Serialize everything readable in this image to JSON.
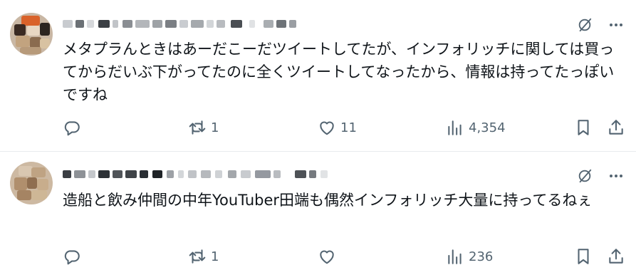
{
  "tweets": [
    {
      "text": "メタプラんときはあーだこーだツイートしてたが、インフォリッチに関しては買ってからだいぶ下がってたのに全くツイートしてなったから、情報は持ってたっぽいですね",
      "reply_count": "",
      "retweet_count": "1",
      "like_count": "11",
      "view_count": "4,354"
    },
    {
      "text": "造船と飲み仲間の中年YouTuber田端も偶然インフォリッチ大量に持ってるねぇ",
      "reply_count": "",
      "retweet_count": "1",
      "like_count": "",
      "view_count": "236"
    }
  ],
  "icons": {
    "reply": "reply-icon",
    "retweet": "retweet-icon",
    "like": "heart-icon",
    "views": "views-icon",
    "bookmark": "bookmark-icon",
    "share": "share-icon",
    "grok": "grok-icon",
    "more": "more-icon"
  },
  "colors": {
    "icon_gray": "#536471",
    "text": "#0f1419",
    "divider": "#e8ebee"
  }
}
